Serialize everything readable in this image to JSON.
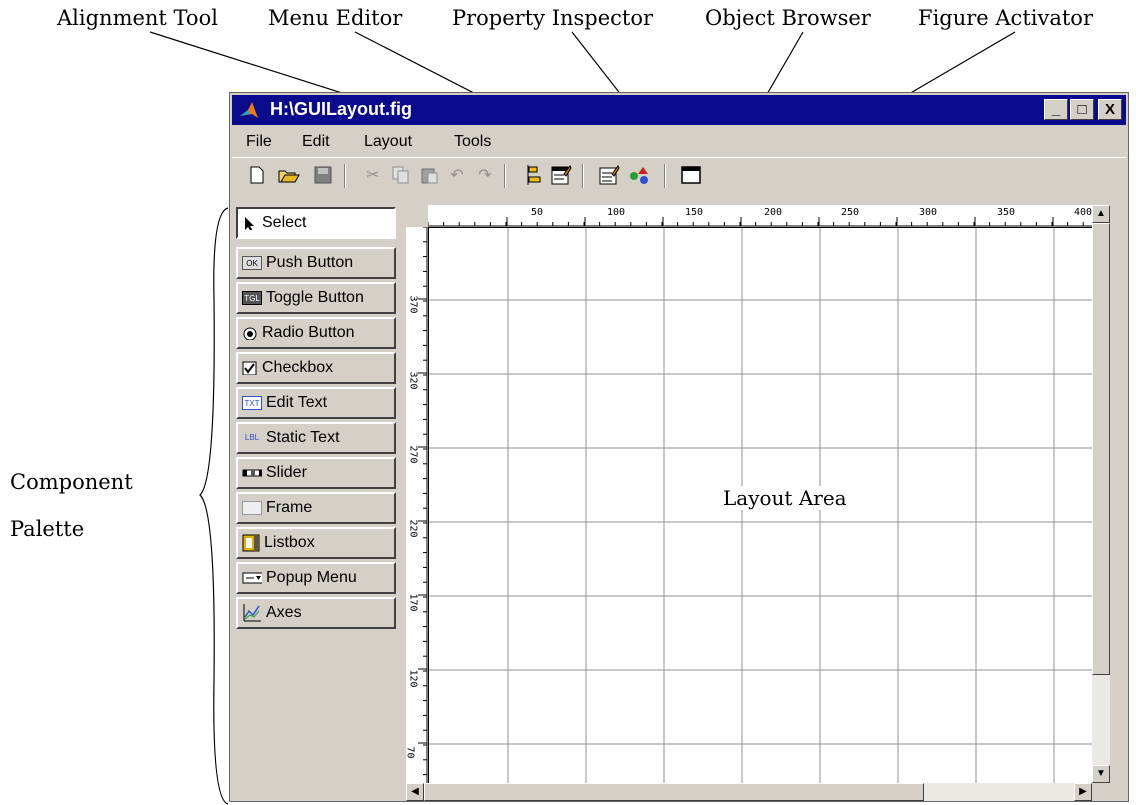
{
  "callouts": {
    "alignment_tool": "Alignment Tool",
    "menu_editor": "Menu Editor",
    "property_inspector": "Property Inspector",
    "object_browser": "Object Browser",
    "figure_activator": "Figure Activator",
    "component_line1": "Component",
    "component_line2": "Palette",
    "layout_area": "Layout Area"
  },
  "window": {
    "title": "H:\\GUILayout.fig",
    "controls": {
      "minimize": "_",
      "maximize": "□",
      "close": "X"
    },
    "title_bar_color": "#0a0a8c",
    "face_color": "#d4d0c8"
  },
  "menu": {
    "file": "File",
    "edit": "Edit",
    "layout": "Layout",
    "tools": "Tools"
  },
  "toolbar": {
    "icons": [
      "new-file-icon",
      "open-folder-icon",
      "save-icon",
      "cut-icon",
      "copy-icon",
      "paste-icon",
      "undo-icon",
      "redo-icon",
      "alignment-tool-icon",
      "menu-editor-icon",
      "property-inspector-icon",
      "object-browser-icon",
      "figure-activator-icon"
    ]
  },
  "palette": {
    "items": [
      {
        "label": "Select",
        "icon": "arrow-cursor-icon"
      },
      {
        "label": "Push Button",
        "icon": "push-button-icon"
      },
      {
        "label": "Toggle Button",
        "icon": "toggle-button-icon"
      },
      {
        "label": "Radio Button",
        "icon": "radio-button-icon"
      },
      {
        "label": "Checkbox",
        "icon": "checkbox-icon"
      },
      {
        "label": "Edit Text",
        "icon": "edit-text-icon"
      },
      {
        "label": "Static Text",
        "icon": "static-text-icon"
      },
      {
        "label": "Slider",
        "icon": "slider-icon"
      },
      {
        "label": "Frame",
        "icon": "frame-icon"
      },
      {
        "label": "Listbox",
        "icon": "listbox-icon"
      },
      {
        "label": "Popup Menu",
        "icon": "popup-menu-icon"
      },
      {
        "label": "Axes",
        "icon": "axes-icon"
      }
    ],
    "icon_text": {
      "push_button": "OK",
      "toggle_button": "TGL",
      "edit_text": "TXT",
      "static_text": "LBL"
    }
  },
  "rulers": {
    "horizontal": [
      "50",
      "100",
      "150",
      "200",
      "250",
      "300",
      "350",
      "400"
    ],
    "vertical": [
      "370",
      "320",
      "270",
      "220",
      "170",
      "120",
      "70"
    ]
  }
}
